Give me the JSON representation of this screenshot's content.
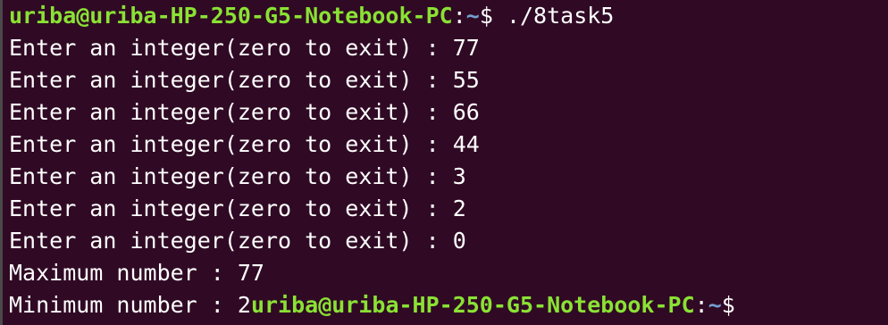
{
  "terminal": {
    "prompt": {
      "user_host": "uriba@uriba-HP-250-G5-Notebook-PC",
      "colon": ":",
      "path": "~",
      "symbol": "$ ",
      "command": "./8task5"
    },
    "lines": [
      "Enter an integer(zero to exit) : 77",
      "Enter an integer(zero to exit) : 55",
      "Enter an integer(zero to exit) : 66",
      "Enter an integer(zero to exit) : 44",
      "Enter an integer(zero to exit) : 3",
      "Enter an integer(zero to exit) : 2",
      "Enter an integer(zero to exit) : 0",
      "Maximum number : 77"
    ],
    "last_line": {
      "output": "Minimum number : 2",
      "user_host": "uriba@uriba-HP-250-G5-Notebook-PC",
      "colon": ":",
      "path": "~",
      "symbol": "$"
    },
    "colors": {
      "background": "#300a24",
      "user_host": "#8ae234",
      "path": "#729fcf",
      "text": "#ffffff"
    }
  }
}
